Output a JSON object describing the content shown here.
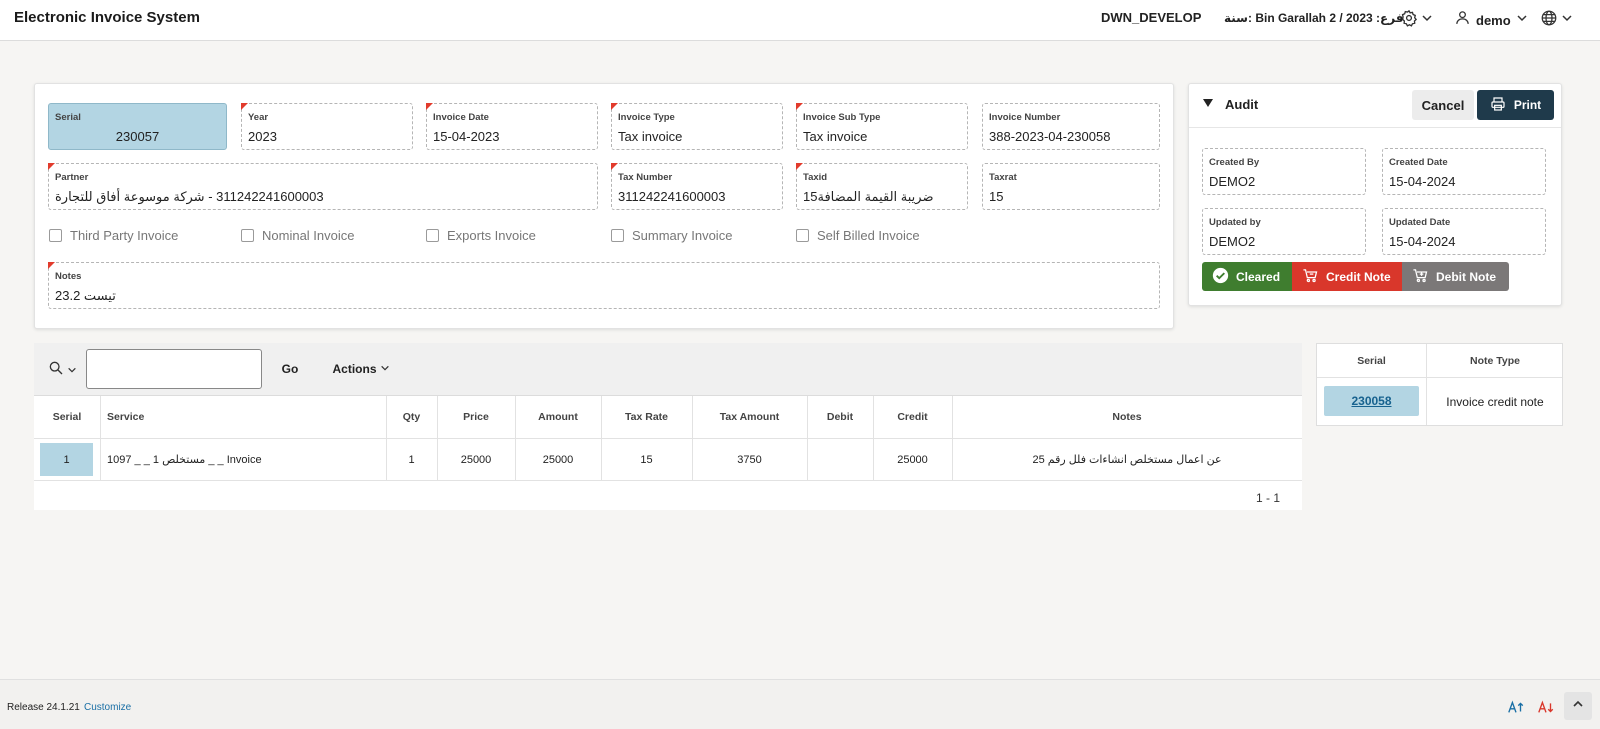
{
  "header": {
    "app_title": "Electronic Invoice System",
    "environment": "DWN_DEVELOP",
    "branch_info": "فرع: Bin Garallah 2 / 2023 :سنة",
    "user": "demo",
    "icons": [
      "gear-icon",
      "user-icon",
      "globe-icon",
      "chevron-down-icon"
    ]
  },
  "invoice": {
    "serial": {
      "label": "Serial",
      "value": "230057"
    },
    "year": {
      "label": "Year",
      "value": "2023"
    },
    "invoice_date": {
      "label": "Invoice Date",
      "value": "15-04-2023"
    },
    "invoice_type": {
      "label": "Invoice Type",
      "value": "Tax invoice"
    },
    "invoice_sub_type": {
      "label": "Invoice Sub Type",
      "value": "Tax invoice"
    },
    "invoice_number": {
      "label": "Invoice Number",
      "value": "388-2023-04-230058"
    },
    "partner": {
      "label": "Partner",
      "value": "311242241600003 - شركة موسوعة أفاق للتجارة"
    },
    "tax_number": {
      "label": "Tax Number",
      "value": "311242241600003"
    },
    "taxid": {
      "label": "Taxid",
      "value": "ضريبة القيمة المضافة15"
    },
    "taxrat": {
      "label": "Taxrat",
      "value": "15"
    },
    "checkboxes": {
      "third_party": "Third Party Invoice",
      "nominal": "Nominal Invoice",
      "exports": "Exports Invoice",
      "summary": "Summary Invoice",
      "self_billed": "Self Billed Invoice"
    },
    "notes": {
      "label": "Notes",
      "value": "تيست 23.2"
    }
  },
  "audit": {
    "title": "Audit",
    "cancel_label": "Cancel",
    "print_label": "Print",
    "created_by": {
      "label": "Created By",
      "value": "DEMO2"
    },
    "created_date": {
      "label": "Created Date",
      "value": "15-04-2024"
    },
    "updated_by": {
      "label": "Updated by",
      "value": "DEMO2"
    },
    "updated_date": {
      "label": "Updated Date",
      "value": "15-04-2024"
    },
    "status_buttons": {
      "cleared": "Cleared",
      "credit_note": "Credit Note",
      "debit_note": "Debit Note"
    },
    "colors": {
      "cleared": "#3f7d2f",
      "credit_note": "#d9372b",
      "debit_note": "#7b7878",
      "print": "#1f3a4b"
    }
  },
  "grid": {
    "search_value": "",
    "go_label": "Go",
    "actions_label": "Actions",
    "columns": {
      "serial": "Serial",
      "service": "Service",
      "qty": "Qty",
      "price": "Price",
      "amount": "Amount",
      "tax_rate": "Tax Rate",
      "tax_amount": "Tax Amount",
      "debit": "Debit",
      "credit": "Credit",
      "notes": "Notes"
    },
    "rows": [
      {
        "serial": "1",
        "service": "1097 _ _ 1 مستخلص _ _ Invoice",
        "qty": "1",
        "price": "25000",
        "amount": "25000",
        "tax_rate": "15",
        "tax_amount": "3750",
        "debit": "",
        "credit": "25000",
        "notes": "عن اعمال مستخلص انشاءات فلل رقم 25"
      }
    ],
    "pagination": "1 - 1"
  },
  "notes_table": {
    "columns": {
      "serial": "Serial",
      "note_type": "Note Type"
    },
    "rows": [
      {
        "serial": "230058",
        "note_type": "Invoice credit note"
      }
    ]
  },
  "footer": {
    "release": "Release 24.1.21",
    "customize": "Customize",
    "icons": [
      "font-increase-icon",
      "font-decrease-icon",
      "scroll-top-icon"
    ]
  }
}
